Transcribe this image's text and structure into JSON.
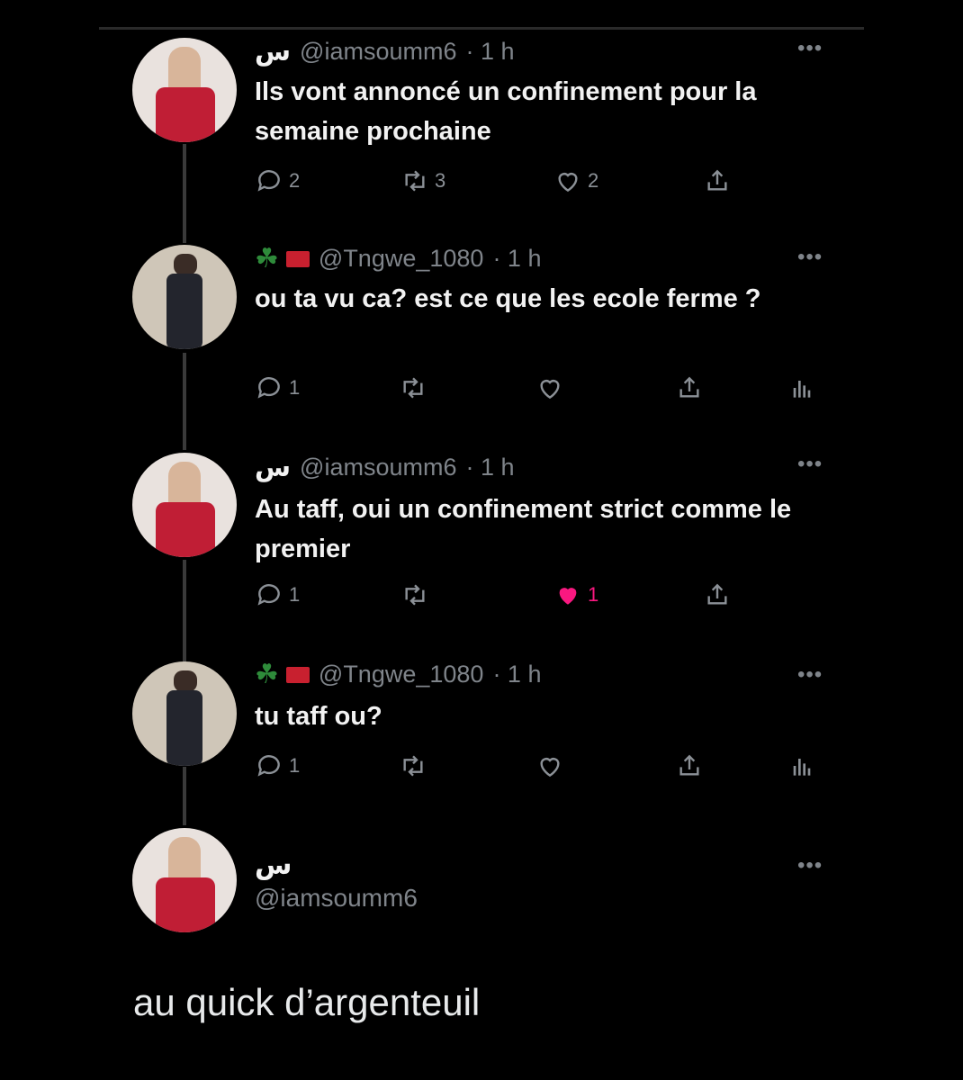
{
  "tweets": [
    {
      "name": "س",
      "handle": "@iamsoumm6",
      "time": "· 1 h",
      "text": "Ils vont annoncé un confinement pour la semaine prochaine",
      "replies": "2",
      "retweets": "3",
      "likes": "2",
      "liked": false,
      "show_analytics": false
    },
    {
      "name": "",
      "handle": "@Tngwe_1080",
      "time": "· 1 h",
      "text": "ou ta vu ca? est ce que les ecole ferme ?",
      "replies": "1",
      "retweets": "",
      "likes": "",
      "liked": false,
      "show_analytics": true
    },
    {
      "name": "س",
      "handle": "@iamsoumm6",
      "time": "· 1 h",
      "text": "Au taff, oui un confinement strict comme le premier",
      "replies": "1",
      "retweets": "",
      "likes": "1",
      "liked": true,
      "show_analytics": false
    },
    {
      "name": "",
      "handle": "@Tngwe_1080",
      "time": "· 1 h",
      "text": "tu taff ou?",
      "replies": "1",
      "retweets": "",
      "likes": "",
      "liked": false,
      "show_analytics": true
    }
  ],
  "final": {
    "name": "س",
    "handle": "@iamsoumm6"
  },
  "reply_text": "au quick d’argenteuil",
  "colors": {
    "like_active": "#f91880",
    "muted": "#7f848a"
  }
}
